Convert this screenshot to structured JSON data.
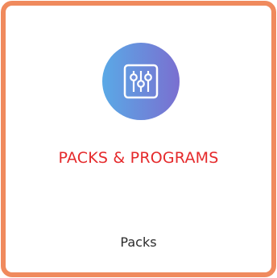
{
  "card": {
    "icon": "sliders-equalizer-icon",
    "title": "PACKS & PROGRAMS",
    "subtitle": "Packs"
  },
  "colors": {
    "border": "#f08a5d",
    "title": "#e5292b",
    "gradient_start": "#5aa9e6",
    "gradient_end": "#7a6fd0"
  }
}
